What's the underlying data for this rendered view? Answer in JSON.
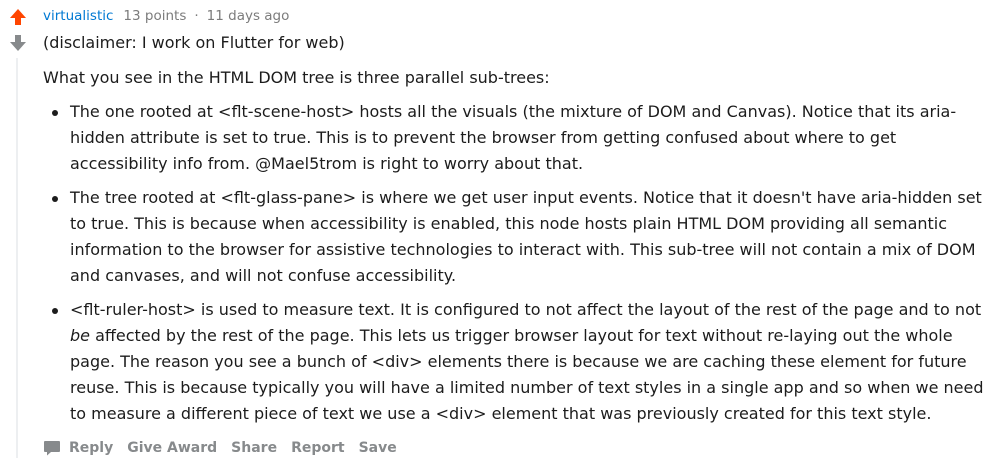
{
  "comment": {
    "author": "virtualistic",
    "points": "13 points",
    "separator": "·",
    "time": "11 days ago",
    "disclaimer": "(disclaimer: I work on Flutter for web)",
    "intro": "What you see in the HTML DOM tree is three parallel sub-trees:",
    "bullets": [
      "The one rooted at <flt-scene-host> hosts all the visuals (the mixture of DOM and Canvas). Notice that its aria-hidden attribute is set to true. This is to prevent the browser from getting confused about where to get accessibility info from. @Mael5trom is right to worry about that.",
      "The tree rooted at <flt-glass-pane> is where we get user input events. Notice that it doesn't have aria-hidden set to true. This is because when accessibility is enabled, this node hosts plain HTML DOM providing all semantic information to the browser for assistive technologies to interact with. This sub-tree will not contain a mix of DOM and canvases, and will not confuse accessibility."
    ],
    "bullet3": {
      "part1": "<flt-ruler-host> is used to measure text. It is configured to not affect the layout of the rest of the page and to not ",
      "emphasis": "be",
      "part2": " affected by the rest of the page. This lets us trigger browser layout for text without re-laying out the whole page. The reason you see a bunch of <div> elements there is because we are caching these element for future reuse. This is because typically you will have a limited number of text styles in a single app and so when we need to measure a different piece of text we use a <div> element that was previously created for this text style."
    }
  },
  "actions": {
    "reply": "Reply",
    "give_award": "Give Award",
    "share": "Share",
    "report": "Report",
    "save": "Save"
  },
  "icons": {
    "upvote": "upvote-arrow-icon",
    "downvote": "downvote-arrow-icon",
    "reply": "speech-bubble-icon"
  },
  "colors": {
    "upvote_active": "#ff4500",
    "downvote": "#878a8c",
    "author": "#0079d3",
    "muted": "#7c7c7c",
    "action": "#878a8c"
  }
}
